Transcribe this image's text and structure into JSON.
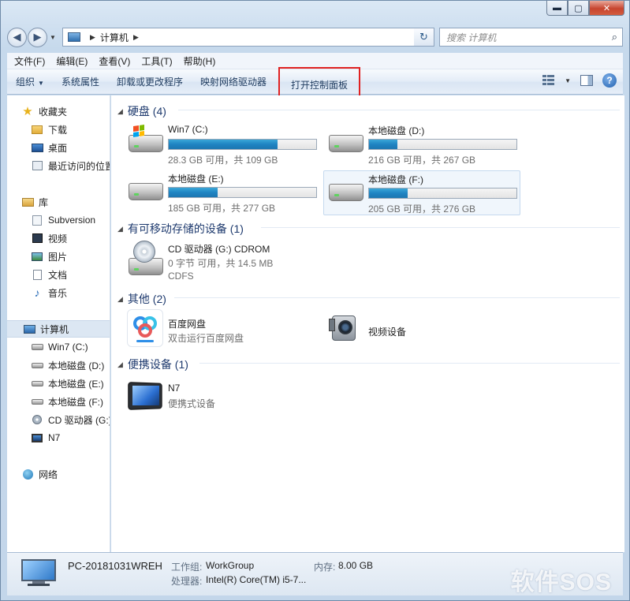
{
  "window": {
    "buttons": {
      "minimize": "▬",
      "maximize": "▢",
      "close": "✕"
    }
  },
  "address": {
    "path": "计算机",
    "search_placeholder": "搜索 计算机"
  },
  "menu": [
    "文件(F)",
    "编辑(E)",
    "查看(V)",
    "工具(T)",
    "帮助(H)"
  ],
  "commands": {
    "organize": "组织",
    "system_properties": "系统属性",
    "uninstall": "卸载或更改程序",
    "map_drive": "映射网络驱动器",
    "control_panel": "打开控制面板"
  },
  "nav": {
    "favorites": "收藏夹",
    "downloads": "下载",
    "desktop": "桌面",
    "recent": "最近访问的位置",
    "libraries": "库",
    "subversion": "Subversion",
    "videos": "视频",
    "pictures": "图片",
    "documents": "文档",
    "music": "音乐",
    "computer": "计算机",
    "drive_c": "Win7 (C:)",
    "drive_d": "本地磁盘 (D:)",
    "drive_e": "本地磁盘 (E:)",
    "drive_f": "本地磁盘 (F:)",
    "drive_g": "CD 驱动器 (G:)",
    "n7": "N7",
    "network": "网络"
  },
  "groups": {
    "hard_disks": "硬盘 (4)",
    "removable": "有可移动存储的设备 (1)",
    "other": "其他 (2)",
    "portable": "便携设备 (1)"
  },
  "drives": [
    {
      "name": "Win7 (C:)",
      "free": "28.3 GB 可用，共 109 GB",
      "used_fraction": 0.74
    },
    {
      "name": "本地磁盘 (D:)",
      "free": "216 GB 可用，共 267 GB",
      "used_fraction": 0.19
    },
    {
      "name": "本地磁盘 (E:)",
      "free": "185 GB 可用，共 277 GB",
      "used_fraction": 0.33
    },
    {
      "name": "本地磁盘 (F:)",
      "free": "205 GB 可用，共 276 GB",
      "used_fraction": 0.26
    }
  ],
  "cdrom": {
    "name": "CD 驱动器 (G:) CDROM",
    "free": "0 字节 可用，共 14.5 MB",
    "fs": "CDFS"
  },
  "others": [
    {
      "name": "百度网盘",
      "sub": "双击运行百度网盘"
    },
    {
      "name": "视频设备",
      "sub": ""
    }
  ],
  "portable": {
    "name": "N7",
    "sub": "便携式设备"
  },
  "status": {
    "pc_name": "PC-20181031WREH",
    "workgroup_label": "工作组:",
    "workgroup": "WorkGroup",
    "memory_label": "内存:",
    "memory": "8.00 GB",
    "cpu_label": "处理器:",
    "cpu": "Intel(R) Core(TM) i5-7..."
  },
  "watermark": "软件SOS",
  "colors": {
    "accent": "#1f84c2",
    "highlight_box": "#e02222"
  }
}
